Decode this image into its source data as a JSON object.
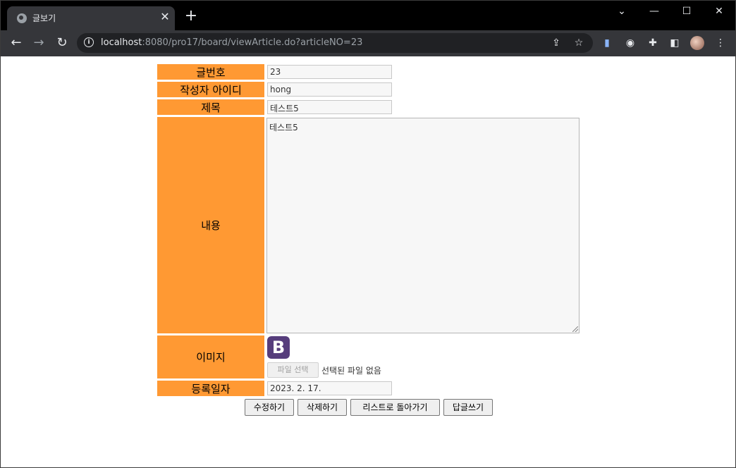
{
  "browser": {
    "tab_title": "글보기",
    "url_host": "localhost",
    "url_rest": ":8080/pro17/board/viewArticle.do?articleNO=23"
  },
  "form": {
    "article_no_label": "글번호",
    "article_no_value": "23",
    "writer_label": "작성자 아이디",
    "writer_value": "hong",
    "title_label": "제목",
    "title_value": "테스트5",
    "content_label": "내용",
    "content_value": "테스트5",
    "image_label": "이미지",
    "image_logo_letter": "B",
    "file_button": "파일 선택",
    "file_status": "선택된 파일 없음",
    "date_label": "등록일자",
    "date_value": "2023. 2. 17."
  },
  "buttons": {
    "modify": "수정하기",
    "delete": "삭제하기",
    "list": "리스트로 돌아가기",
    "reply": "답글쓰기"
  }
}
